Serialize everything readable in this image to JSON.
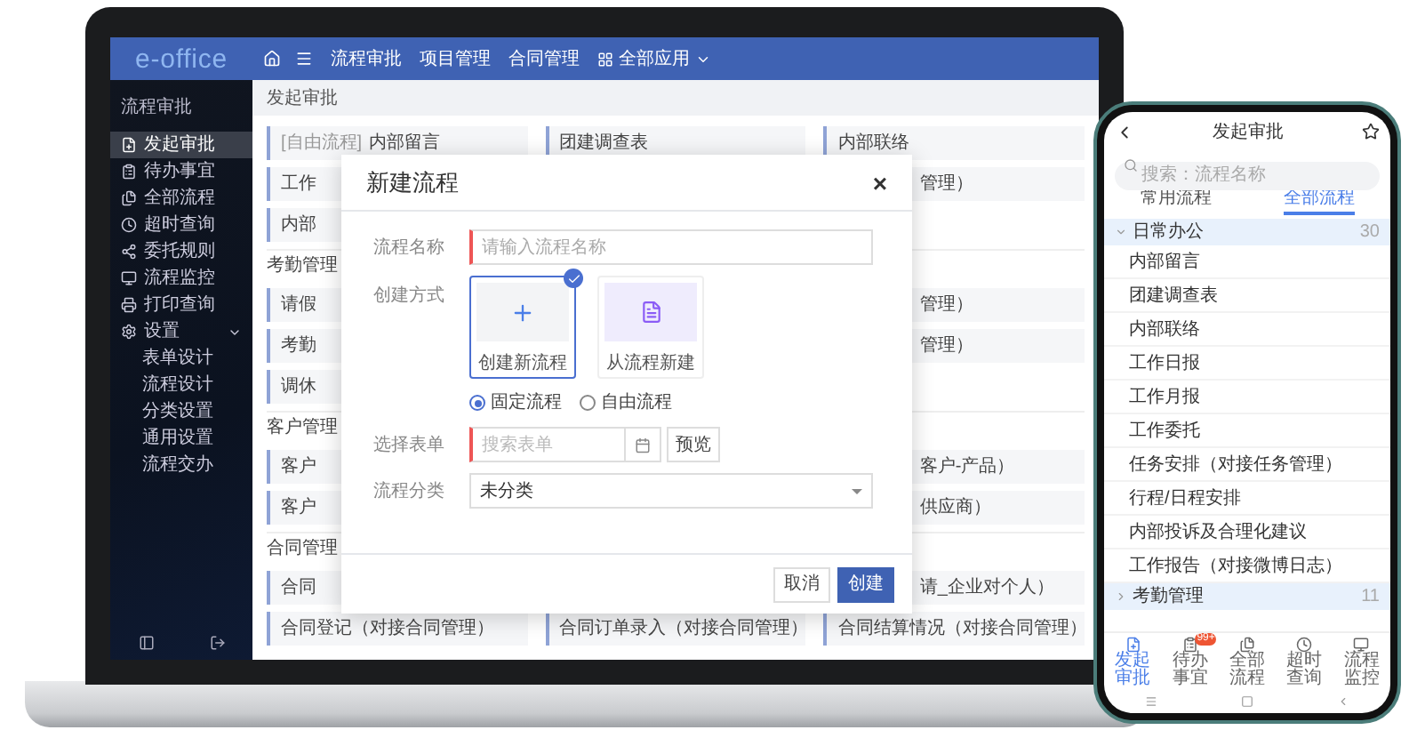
{
  "laptop": {
    "logo": "e-office",
    "top_nav": [
      "流程审批",
      "项目管理",
      "合同管理",
      "全部应用"
    ],
    "sidebar": {
      "title": "流程审批",
      "items": [
        {
          "label": "发起审批",
          "selected": true
        },
        {
          "label": "待办事宜",
          "selected": false
        },
        {
          "label": "全部流程",
          "selected": false
        },
        {
          "label": "超时查询",
          "selected": false
        },
        {
          "label": "委托规则",
          "selected": false
        },
        {
          "label": "流程监控",
          "selected": false
        },
        {
          "label": "打印查询",
          "selected": false
        },
        {
          "label": "设置",
          "selected": false,
          "expanded": true,
          "children": [
            "表单设计",
            "流程设计",
            "分类设置",
            "通用设置",
            "流程交办"
          ]
        }
      ]
    },
    "breadcrumb": "发起审批",
    "sections": [
      {
        "rows": [
          [
            {
              "tag": "[自由流程]",
              "text": "内部留言"
            },
            {
              "text": "团建调查表"
            },
            {
              "text": "内部联络"
            }
          ],
          [
            {
              "text": "工作"
            },
            null,
            {
              "text": "管理）",
              "kind": "clipped"
            }
          ],
          [
            {
              "text": "内部"
            },
            null,
            null
          ]
        ]
      },
      {
        "heading": "考勤管理",
        "rows": [
          [
            {
              "text": "请假"
            },
            null,
            {
              "text": "管理）",
              "kind": "clipped"
            }
          ],
          [
            {
              "text": "考勤"
            },
            null,
            {
              "text": "管理）",
              "kind": "clipped"
            }
          ],
          [
            {
              "text": "调休"
            },
            null,
            null
          ]
        ]
      },
      {
        "heading": "客户管理",
        "rows": [
          [
            {
              "text": "客户"
            },
            null,
            {
              "text": "客户-产品）",
              "kind": "clipped"
            }
          ],
          [
            {
              "text": "客户"
            },
            null,
            {
              "text": "供应商）",
              "kind": "clipped"
            }
          ]
        ]
      },
      {
        "heading": "合同管理",
        "rows": [
          [
            {
              "text": "合同"
            },
            null,
            {
              "text": "请_企业对个人）",
              "kind": "clipped"
            }
          ],
          [
            {
              "text": "合同登记（对接合同管理）"
            },
            {
              "text": "合同订单录入（对接合同管理）"
            },
            {
              "text": "合同结算情况（对接合同管理）"
            }
          ]
        ]
      }
    ],
    "dialog": {
      "title": "新建流程",
      "close": "×",
      "name_label": "流程名称",
      "name_placeholder": "请输入流程名称",
      "mode_label": "创建方式",
      "modes": [
        {
          "label": "创建新流程",
          "kind": "new",
          "selected": true
        },
        {
          "label": "从流程新建",
          "kind": "copy",
          "selected": false
        }
      ],
      "types": [
        {
          "label": "固定流程",
          "selected": true
        },
        {
          "label": "自由流程",
          "selected": false
        }
      ],
      "form_label": "选择表单",
      "form_placeholder": "搜索表单",
      "preview": "预览",
      "category_label": "流程分类",
      "category_value": "未分类",
      "cancel": "取消",
      "create": "创建"
    }
  },
  "phone": {
    "title": "发起审批",
    "search_placeholder": "搜索：流程名称",
    "tabs": [
      {
        "label": "常用流程",
        "selected": false
      },
      {
        "label": "全部流程",
        "selected": true
      }
    ],
    "groups": [
      {
        "label": "日常办公",
        "count": "30",
        "expanded": true,
        "items": [
          "内部留言",
          "团建调查表",
          "内部联络",
          "工作日报",
          "工作月报",
          "工作委托",
          "任务安排（对接任务管理）",
          "行程/日程安排",
          "内部投诉及合理化建议",
          "工作报告（对接微博日志）"
        ]
      },
      {
        "label": "考勤管理",
        "count": "11",
        "expanded": false
      }
    ],
    "nav": [
      {
        "label": "发起审批",
        "selected": true
      },
      {
        "label": "待办事宜",
        "selected": false,
        "badge": "99+"
      },
      {
        "label": "全部流程",
        "selected": false
      },
      {
        "label": "超时查询",
        "selected": false
      },
      {
        "label": "流程监控",
        "selected": false
      }
    ]
  }
}
